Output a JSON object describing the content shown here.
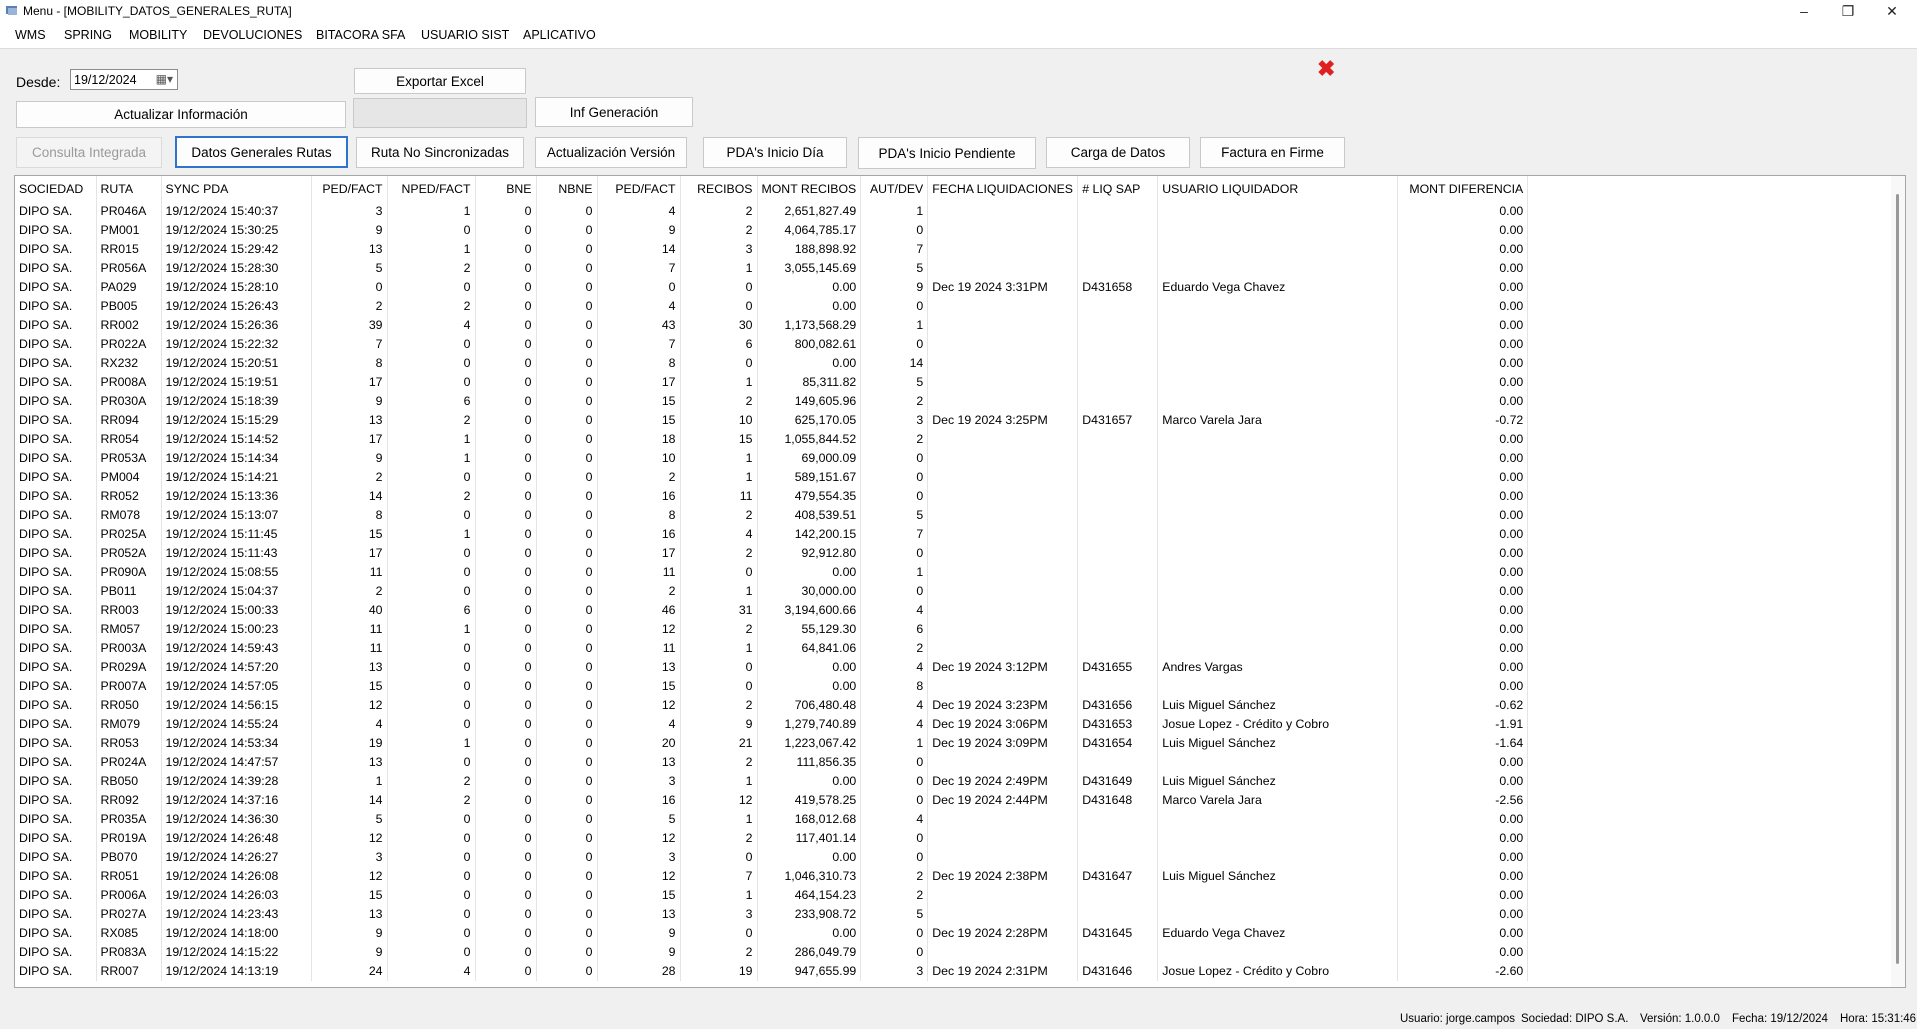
{
  "window": {
    "title": "Menu - [MOBILITY_DATOS_GENERALES_RUTA]",
    "minimize": "–",
    "maximize": "❐",
    "close": "✕"
  },
  "menu": [
    "WMS",
    "SPRING",
    "MOBILITY",
    "DEVOLUCIONES",
    "BITACORA SFA",
    "USUARIO SIST",
    "APLICATIVO"
  ],
  "filters": {
    "desde_label": "Desde:",
    "desde_value": "19/12/2024"
  },
  "buttons": {
    "exportar": "Exportar Excel",
    "actualizar": "Actualizar Información",
    "inf_generacion": "Inf Generación"
  },
  "tabs": [
    {
      "label": "Consulta Integrada",
      "state": "disabled"
    },
    {
      "label": "Datos Generales Rutas",
      "state": "active"
    },
    {
      "label": "Ruta No Sincronizadas",
      "state": "normal"
    },
    {
      "label": "Actualización Versión",
      "state": "normal"
    },
    {
      "label": "PDA's Inicio Día",
      "state": "normal"
    },
    {
      "label": "PDA's Inicio Pendiente",
      "state": "normal"
    },
    {
      "label": "Carga de Datos",
      "state": "normal"
    },
    {
      "label": "Factura en Firme",
      "state": "normal"
    }
  ],
  "grid": {
    "columns": [
      "SOCIEDAD",
      "RUTA",
      "SYNC PDA",
      "PED/FACT",
      "NPED/FACT",
      "BNE",
      "NBNE",
      "PED/FACT",
      "RECIBOS",
      "MONT RECIBOS",
      "AUT/DEV",
      "FECHA LIQUIDACIONES",
      "# LIQ SAP",
      "USUARIO LIQUIDADOR",
      "MONT DIFERENCIA"
    ],
    "rows": [
      [
        "DIPO SA.",
        "PR046A",
        "19/12/2024 15:40:37",
        "3",
        "1",
        "0",
        "0",
        "4",
        "2",
        "2,651,827.49",
        "1",
        "",
        "",
        "",
        "0.00"
      ],
      [
        "DIPO SA.",
        "PM001",
        "19/12/2024 15:30:25",
        "9",
        "0",
        "0",
        "0",
        "9",
        "2",
        "4,064,785.17",
        "0",
        "",
        "",
        "",
        "0.00"
      ],
      [
        "DIPO SA.",
        "RR015",
        "19/12/2024 15:29:42",
        "13",
        "1",
        "0",
        "0",
        "14",
        "3",
        "188,898.92",
        "7",
        "",
        "",
        "",
        "0.00"
      ],
      [
        "DIPO SA.",
        "PR056A",
        "19/12/2024 15:28:30",
        "5",
        "2",
        "0",
        "0",
        "7",
        "1",
        "3,055,145.69",
        "5",
        "",
        "",
        "",
        "0.00"
      ],
      [
        "DIPO SA.",
        "PA029",
        "19/12/2024 15:28:10",
        "0",
        "0",
        "0",
        "0",
        "0",
        "0",
        "0.00",
        "9",
        "Dec 19 2024  3:31PM",
        "D431658",
        "Eduardo Vega Chavez",
        "0.00"
      ],
      [
        "DIPO SA.",
        "PB005",
        "19/12/2024 15:26:43",
        "2",
        "2",
        "0",
        "0",
        "4",
        "0",
        "0.00",
        "0",
        "",
        "",
        "",
        "0.00"
      ],
      [
        "DIPO SA.",
        "RR002",
        "19/12/2024 15:26:36",
        "39",
        "4",
        "0",
        "0",
        "43",
        "30",
        "1,173,568.29",
        "1",
        "",
        "",
        "",
        "0.00"
      ],
      [
        "DIPO SA.",
        "PR022A",
        "19/12/2024 15:22:32",
        "7",
        "0",
        "0",
        "0",
        "7",
        "6",
        "800,082.61",
        "0",
        "",
        "",
        "",
        "0.00"
      ],
      [
        "DIPO SA.",
        "RX232",
        "19/12/2024 15:20:51",
        "8",
        "0",
        "0",
        "0",
        "8",
        "0",
        "0.00",
        "14",
        "",
        "",
        "",
        "0.00"
      ],
      [
        "DIPO SA.",
        "PR008A",
        "19/12/2024 15:19:51",
        "17",
        "0",
        "0",
        "0",
        "17",
        "1",
        "85,311.82",
        "5",
        "",
        "",
        "",
        "0.00"
      ],
      [
        "DIPO SA.",
        "PR030A",
        "19/12/2024 15:18:39",
        "9",
        "6",
        "0",
        "0",
        "15",
        "2",
        "149,605.96",
        "2",
        "",
        "",
        "",
        "0.00"
      ],
      [
        "DIPO SA.",
        "RR094",
        "19/12/2024 15:15:29",
        "13",
        "2",
        "0",
        "0",
        "15",
        "10",
        "625,170.05",
        "3",
        "Dec 19 2024  3:25PM",
        "D431657",
        "Marco Varela Jara",
        "-0.72"
      ],
      [
        "DIPO SA.",
        "RR054",
        "19/12/2024 15:14:52",
        "17",
        "1",
        "0",
        "0",
        "18",
        "15",
        "1,055,844.52",
        "2",
        "",
        "",
        "",
        "0.00"
      ],
      [
        "DIPO SA.",
        "PR053A",
        "19/12/2024 15:14:34",
        "9",
        "1",
        "0",
        "0",
        "10",
        "1",
        "69,000.09",
        "0",
        "",
        "",
        "",
        "0.00"
      ],
      [
        "DIPO SA.",
        "PM004",
        "19/12/2024 15:14:21",
        "2",
        "0",
        "0",
        "0",
        "2",
        "1",
        "589,151.67",
        "0",
        "",
        "",
        "",
        "0.00"
      ],
      [
        "DIPO SA.",
        "RR052",
        "19/12/2024 15:13:36",
        "14",
        "2",
        "0",
        "0",
        "16",
        "11",
        "479,554.35",
        "0",
        "",
        "",
        "",
        "0.00"
      ],
      [
        "DIPO SA.",
        "RM078",
        "19/12/2024 15:13:07",
        "8",
        "0",
        "0",
        "0",
        "8",
        "2",
        "408,539.51",
        "5",
        "",
        "",
        "",
        "0.00"
      ],
      [
        "DIPO SA.",
        "PR025A",
        "19/12/2024 15:11:45",
        "15",
        "1",
        "0",
        "0",
        "16",
        "4",
        "142,200.15",
        "7",
        "",
        "",
        "",
        "0.00"
      ],
      [
        "DIPO SA.",
        "PR052A",
        "19/12/2024 15:11:43",
        "17",
        "0",
        "0",
        "0",
        "17",
        "2",
        "92,912.80",
        "0",
        "",
        "",
        "",
        "0.00"
      ],
      [
        "DIPO SA.",
        "PR090A",
        "19/12/2024 15:08:55",
        "11",
        "0",
        "0",
        "0",
        "11",
        "0",
        "0.00",
        "1",
        "",
        "",
        "",
        "0.00"
      ],
      [
        "DIPO SA.",
        "PB011",
        "19/12/2024 15:04:37",
        "2",
        "0",
        "0",
        "0",
        "2",
        "1",
        "30,000.00",
        "0",
        "",
        "",
        "",
        "0.00"
      ],
      [
        "DIPO SA.",
        "RR003",
        "19/12/2024 15:00:33",
        "40",
        "6",
        "0",
        "0",
        "46",
        "31",
        "3,194,600.66",
        "4",
        "",
        "",
        "",
        "0.00"
      ],
      [
        "DIPO SA.",
        "RM057",
        "19/12/2024 15:00:23",
        "11",
        "1",
        "0",
        "0",
        "12",
        "2",
        "55,129.30",
        "6",
        "",
        "",
        "",
        "0.00"
      ],
      [
        "DIPO SA.",
        "PR003A",
        "19/12/2024 14:59:43",
        "11",
        "0",
        "0",
        "0",
        "11",
        "1",
        "64,841.06",
        "2",
        "",
        "",
        "",
        "0.00"
      ],
      [
        "DIPO SA.",
        "PR029A",
        "19/12/2024 14:57:20",
        "13",
        "0",
        "0",
        "0",
        "13",
        "0",
        "0.00",
        "4",
        "Dec 19 2024  3:12PM",
        "D431655",
        "Andres Vargas",
        "0.00"
      ],
      [
        "DIPO SA.",
        "PR007A",
        "19/12/2024 14:57:05",
        "15",
        "0",
        "0",
        "0",
        "15",
        "0",
        "0.00",
        "8",
        "",
        "",
        "",
        "0.00"
      ],
      [
        "DIPO SA.",
        "RR050",
        "19/12/2024 14:56:15",
        "12",
        "0",
        "0",
        "0",
        "12",
        "2",
        "706,480.48",
        "4",
        "Dec 19 2024  3:23PM",
        "D431656",
        "Luis Miguel Sánchez",
        "-0.62"
      ],
      [
        "DIPO SA.",
        "RM079",
        "19/12/2024 14:55:24",
        "4",
        "0",
        "0",
        "0",
        "4",
        "9",
        "1,279,740.89",
        "4",
        "Dec 19 2024  3:06PM",
        "D431653",
        "Josue Lopez - Crédito y Cobro",
        "-1.91"
      ],
      [
        "DIPO SA.",
        "RR053",
        "19/12/2024 14:53:34",
        "19",
        "1",
        "0",
        "0",
        "20",
        "21",
        "1,223,067.42",
        "1",
        "Dec 19 2024  3:09PM",
        "D431654",
        "Luis Miguel Sánchez",
        "-1.64"
      ],
      [
        "DIPO SA.",
        "PR024A",
        "19/12/2024 14:47:57",
        "13",
        "0",
        "0",
        "0",
        "13",
        "2",
        "111,856.35",
        "0",
        "",
        "",
        "",
        "0.00"
      ],
      [
        "DIPO SA.",
        "RB050",
        "19/12/2024 14:39:28",
        "1",
        "2",
        "0",
        "0",
        "3",
        "1",
        "0.00",
        "0",
        "Dec 19 2024  2:49PM",
        "D431649",
        "Luis Miguel Sánchez",
        "0.00"
      ],
      [
        "DIPO SA.",
        "RR092",
        "19/12/2024 14:37:16",
        "14",
        "2",
        "0",
        "0",
        "16",
        "12",
        "419,578.25",
        "0",
        "Dec 19 2024  2:44PM",
        "D431648",
        "Marco Varela Jara",
        "-2.56"
      ],
      [
        "DIPO SA.",
        "PR035A",
        "19/12/2024 14:36:30",
        "5",
        "0",
        "0",
        "0",
        "5",
        "1",
        "168,012.68",
        "4",
        "",
        "",
        "",
        "0.00"
      ],
      [
        "DIPO SA.",
        "PR019A",
        "19/12/2024 14:26:48",
        "12",
        "0",
        "0",
        "0",
        "12",
        "2",
        "117,401.14",
        "0",
        "",
        "",
        "",
        "0.00"
      ],
      [
        "DIPO SA.",
        "PB070",
        "19/12/2024 14:26:27",
        "3",
        "0",
        "0",
        "0",
        "3",
        "0",
        "0.00",
        "0",
        "",
        "",
        "",
        "0.00"
      ],
      [
        "DIPO SA.",
        "RR051",
        "19/12/2024 14:26:08",
        "12",
        "0",
        "0",
        "0",
        "12",
        "7",
        "1,046,310.73",
        "2",
        "Dec 19 2024  2:38PM",
        "D431647",
        "Luis Miguel Sánchez",
        "0.00"
      ],
      [
        "DIPO SA.",
        "PR006A",
        "19/12/2024 14:26:03",
        "15",
        "0",
        "0",
        "0",
        "15",
        "1",
        "464,154.23",
        "2",
        "",
        "",
        "",
        "0.00"
      ],
      [
        "DIPO SA.",
        "PR027A",
        "19/12/2024 14:23:43",
        "13",
        "0",
        "0",
        "0",
        "13",
        "3",
        "233,908.72",
        "5",
        "",
        "",
        "",
        "0.00"
      ],
      [
        "DIPO SA.",
        "RX085",
        "19/12/2024 14:18:00",
        "9",
        "0",
        "0",
        "0",
        "9",
        "0",
        "0.00",
        "0",
        "Dec 19 2024  2:28PM",
        "D431645",
        "Eduardo Vega Chavez",
        "0.00"
      ],
      [
        "DIPO SA.",
        "PR083A",
        "19/12/2024 14:15:22",
        "9",
        "0",
        "0",
        "0",
        "9",
        "2",
        "286,049.79",
        "0",
        "",
        "",
        "",
        "0.00"
      ],
      [
        "DIPO SA.",
        "RR007",
        "19/12/2024 14:13:19",
        "24",
        "4",
        "0",
        "0",
        "28",
        "19",
        "947,655.99",
        "3",
        "Dec 19 2024  2:31PM",
        "D431646",
        "Josue Lopez - Crédito y Cobro",
        "-2.60"
      ]
    ]
  },
  "status": {
    "usuario": "Usuario: jorge.campos",
    "sociedad": "Sociedad: DIPO S.A.",
    "version": "Versión: 1.0.0.0",
    "fecha": "Fecha: 19/12/2024",
    "hora": "Hora: 15:31:46"
  },
  "colors": {
    "active_tab_border": "#2f74cc",
    "close_x": "#e02020"
  }
}
